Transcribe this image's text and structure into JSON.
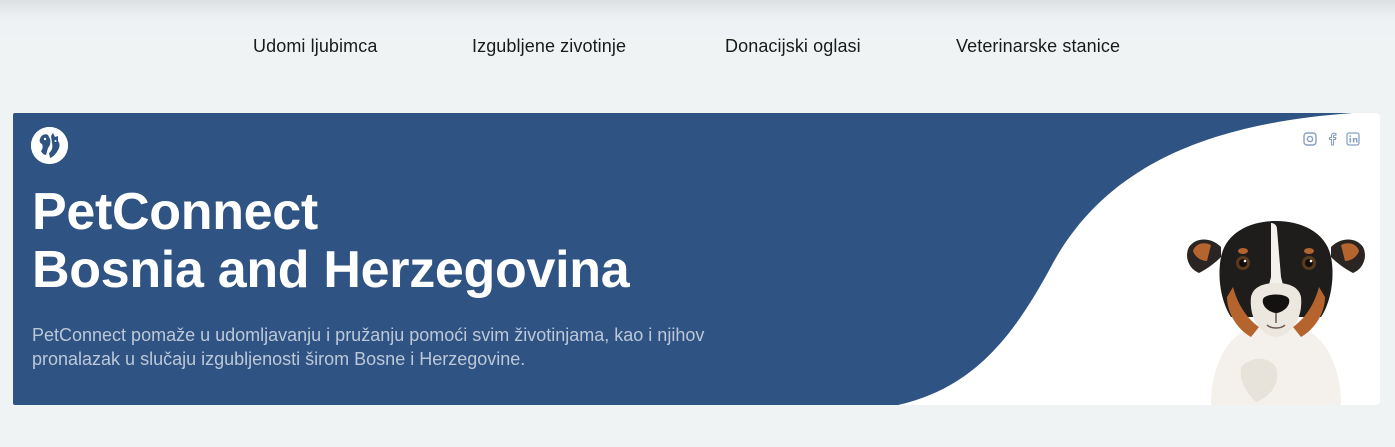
{
  "nav": {
    "items": [
      {
        "label": "Udomi ljubimca"
      },
      {
        "label": "Izgubljene zivotinje"
      },
      {
        "label": "Donacijski oglasi"
      },
      {
        "label": "Veterinarske stanice"
      }
    ]
  },
  "hero": {
    "title_line1": "PetConnect",
    "title_line2": "Bosnia and Herzegovina",
    "desc_line1": "PetConnect pomaže u udomljavanju i pružanju pomoći svim životinjama, kao i njihov",
    "desc_line2": "pronalazak u slučaju izgubljenosti širom Bosne i Herzegovine.",
    "logo_icon": "dog-cat-logo-icon",
    "social": [
      "instagram-icon",
      "facebook-icon",
      "linkedin-icon"
    ]
  },
  "colors": {
    "background": "#eff3f4",
    "hero_blue": "#2f5383",
    "hero_text": "#ffffff",
    "desc_text": "#bcc8d8"
  }
}
